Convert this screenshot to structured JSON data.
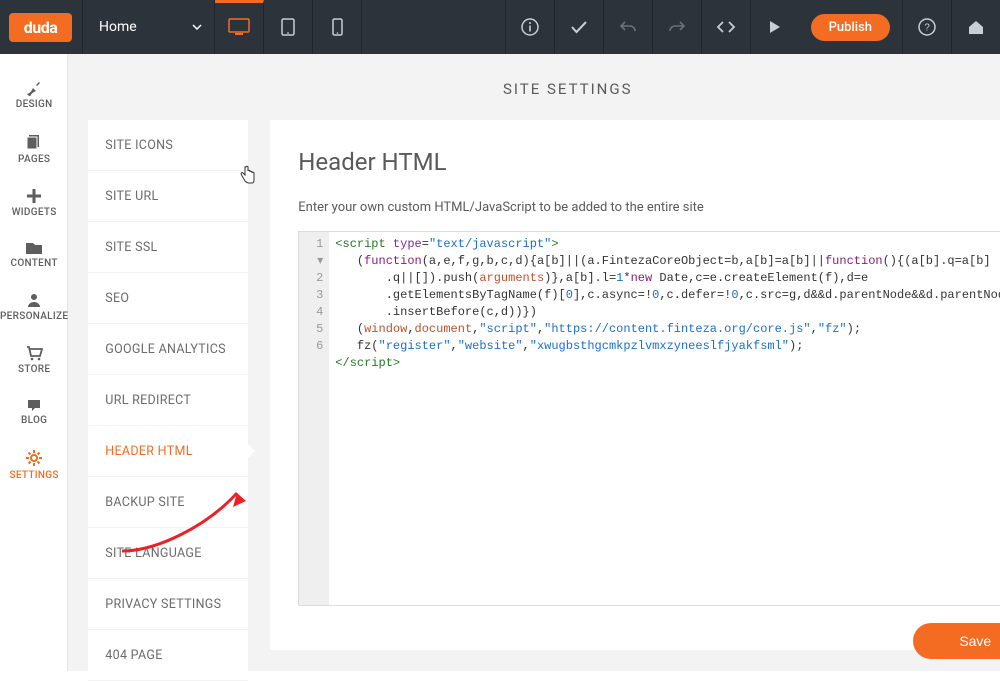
{
  "topbar": {
    "logo_text": "duda",
    "page_dropdown_label": "Home",
    "publish_label": "Publish"
  },
  "leftnav": {
    "items": [
      {
        "label": "DESIGN"
      },
      {
        "label": "PAGES"
      },
      {
        "label": "WIDGETS"
      },
      {
        "label": "CONTENT"
      },
      {
        "label": "PERSONALIZE"
      },
      {
        "label": "STORE"
      },
      {
        "label": "BLOG"
      },
      {
        "label": "SETTINGS"
      }
    ]
  },
  "section_title": "SITE SETTINGS",
  "submenu": {
    "items": [
      {
        "label": "SITE ICONS"
      },
      {
        "label": "SITE URL"
      },
      {
        "label": "SITE SSL"
      },
      {
        "label": "SEO"
      },
      {
        "label": "GOOGLE ANALYTICS"
      },
      {
        "label": "URL REDIRECT"
      },
      {
        "label": "HEADER HTML"
      },
      {
        "label": "BACKUP SITE"
      },
      {
        "label": "SITE LANGUAGE"
      },
      {
        "label": "PRIVACY SETTINGS"
      },
      {
        "label": "404 PAGE"
      }
    ]
  },
  "editor": {
    "title": "Header HTML",
    "description": "Enter your own custom HTML/JavaScript to be added to the entire site",
    "save_label": "Save",
    "code_lines": [
      "1",
      "2",
      "3",
      "4",
      "5",
      "6"
    ]
  },
  "accent": "#f36c21"
}
